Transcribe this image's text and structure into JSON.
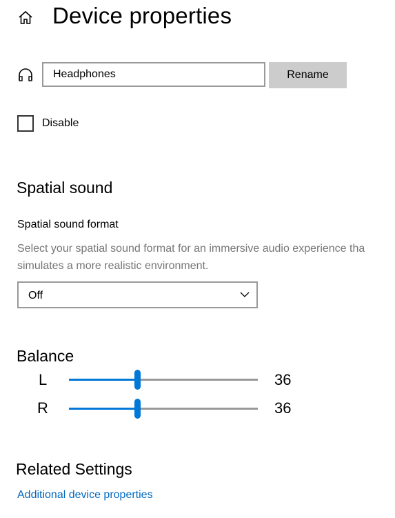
{
  "header": {
    "title": "Device properties",
    "icon": "home-icon"
  },
  "device": {
    "icon": "headphones-icon",
    "name_value": "Headphones",
    "rename_label": "Rename"
  },
  "disable": {
    "label": "Disable",
    "checked": false
  },
  "spatial": {
    "heading": "Spatial sound",
    "format_label": "Spatial sound format",
    "description_line1": "Select your spatial sound format for an immersive audio experience tha",
    "description_line2": "simulates a more realistic environment.",
    "selected": "Off"
  },
  "balance": {
    "heading": "Balance",
    "channels": [
      {
        "label": "L",
        "value": "36",
        "percent": 36
      },
      {
        "label": "R",
        "value": "36",
        "percent": 36
      }
    ]
  },
  "related": {
    "heading": "Related Settings",
    "link": "Additional device properties"
  },
  "colors": {
    "accent": "#0078d7",
    "link": "#0067c0",
    "track": "#999999",
    "button": "#cccccc"
  }
}
